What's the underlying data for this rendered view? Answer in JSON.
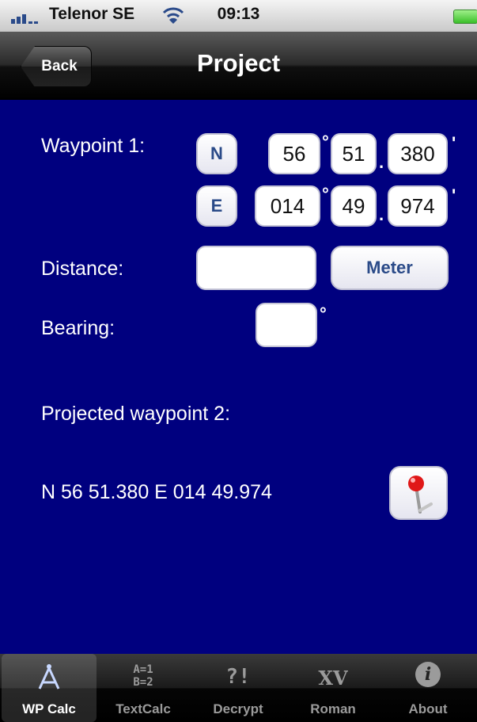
{
  "status_bar": {
    "carrier": "Telenor SE",
    "time": "09:13"
  },
  "nav": {
    "back_label": "Back",
    "title": "Project"
  },
  "form": {
    "waypoint_label": "Waypoint 1:",
    "lat": {
      "hemisphere": "N",
      "degrees": "56",
      "minutes": "51",
      "decimals": "380"
    },
    "lon": {
      "hemisphere": "E",
      "degrees": "014",
      "minutes": "49",
      "decimals": "974"
    },
    "degree_symbol": "°",
    "minute_symbol": "'",
    "dot_symbol": ".",
    "distance_label": "Distance:",
    "distance_value": "",
    "unit_button": "Meter",
    "bearing_label": "Bearing:",
    "bearing_value": "",
    "projected_label": "Projected waypoint 2:",
    "projected_value": "N 56 51.380 E 014 49.974"
  },
  "tabs": [
    {
      "label": "WP Calc",
      "icon": "compass-icon",
      "active": true
    },
    {
      "label": "TextCalc",
      "icon": "textcalc-icon",
      "icon_text_1": "A=1",
      "icon_text_2": "B=2"
    },
    {
      "label": "Decrypt",
      "icon": "decrypt-icon",
      "icon_text": "?!"
    },
    {
      "label": "Roman",
      "icon": "roman-icon",
      "icon_text": "XV"
    },
    {
      "label": "About",
      "icon": "info-icon",
      "icon_text": "i"
    }
  ],
  "colors": {
    "background": "#00007f",
    "button_text": "#2a4a88",
    "pin_red": "#e01818"
  }
}
